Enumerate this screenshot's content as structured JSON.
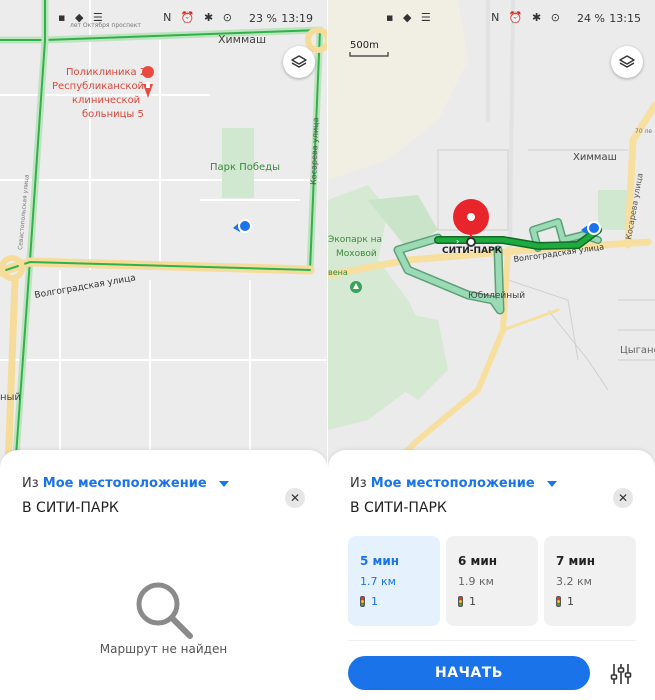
{
  "left": {
    "status": {
      "left_icons": "▪ ◆ ☰",
      "mid_icons": "N ⏰ ✱ ⊙",
      "battery": "23 %",
      "time": "13:19"
    },
    "map_labels": {
      "himmash": "Химмаш",
      "clinic": "Поликлиника 2 Республиканской клинической больницы 5",
      "clinic_l1": "Поликлиника 2",
      "clinic_l2": "Республиканской",
      "clinic_l3": "клинической",
      "clinic_l4": "больницы 5",
      "park": "Парк Победы",
      "kosareva": "Косарева улица",
      "volgograd": "Волгоградская улица",
      "oktober": "лет Октября проспект",
      "sevastopol": "Севастопольская улица",
      "nyi": "ный"
    },
    "sheet": {
      "from_prefix": "Из",
      "from_location": "Мое местоположение",
      "to": "В СИТИ-ПАРК",
      "close": "✕",
      "not_found": "Маршрут не найден"
    }
  },
  "right": {
    "status": {
      "left_icons": "▪ ◆ ☰",
      "mid_icons": "N ⏰ ✱ ⊙",
      "battery": "24 %",
      "time": "13:15"
    },
    "scale": "500m",
    "map_labels": {
      "himmash": "Химмаш",
      "seventy": "70 ле",
      "ekopark_l1": "Экопарк на",
      "ekopark_l2": "Моховой",
      "city_park": "СИТИ-ПАРК",
      "volgograd": "Волгоградская улица",
      "kosareva": "Косарева улица",
      "jubilee": "Юбилейный",
      "vena": "вена",
      "tsygan": "Цыгано"
    },
    "sheet": {
      "from_prefix": "Из",
      "from_location": "Мое местоположение",
      "to": "В СИТИ-ПАРК",
      "close": "✕",
      "routes": [
        {
          "duration": "5 мин",
          "distance": "1.7 км",
          "lights": "1",
          "selected": true
        },
        {
          "duration": "6 мин",
          "distance": "1.9 км",
          "lights": "1",
          "selected": false
        },
        {
          "duration": "7 мин",
          "distance": "3.2 км",
          "lights": "1",
          "selected": false
        }
      ],
      "start": "НАЧАТЬ"
    }
  },
  "colors": {
    "accent": "#1a73e8",
    "route_green": "#1faa3e",
    "route_alt": "#8fd6a8",
    "destination_pin": "#e8252b",
    "map_bg": "#ebebeb",
    "road_yellow": "#f7dfa0"
  }
}
